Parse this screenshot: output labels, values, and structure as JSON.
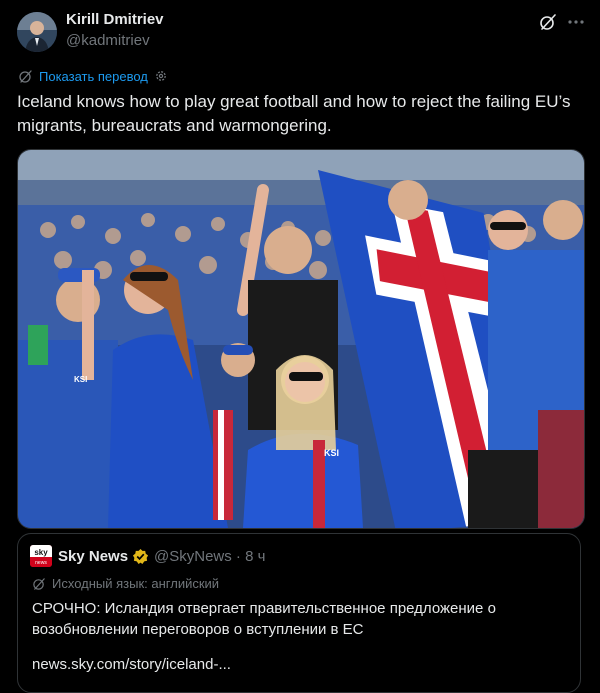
{
  "post": {
    "author": {
      "name": "Kirill Dmitriev",
      "handle": "@kadmitriev"
    },
    "translate_link": "Показать перевод",
    "text": "Iceland knows how to play great football and how to reject the failing EU’s migrants, bureaucrats and warmongering.",
    "media": {
      "badges": [
        "KSI",
        "KSI"
      ]
    }
  },
  "quote": {
    "logo_text": "sky",
    "logo_subtext": "news",
    "name": "Sky News",
    "handle": "@SkyNews",
    "separator": "·",
    "time": "8 ч",
    "language_note": "Исходный язык: английский",
    "text": "СРОЧНО: Исландия отвергает правительственное предложение о возобновлении переговоров о вступлении в ЕС",
    "link": "news.sky.com/story/iceland-..."
  },
  "colors": {
    "accent": "#1d9bf0",
    "background": "#000000",
    "muted": "#71767b",
    "verified": "#e2b719"
  },
  "icons": [
    "grok-icon",
    "more-icon",
    "translate-icon",
    "gear-icon",
    "verified-icon"
  ]
}
